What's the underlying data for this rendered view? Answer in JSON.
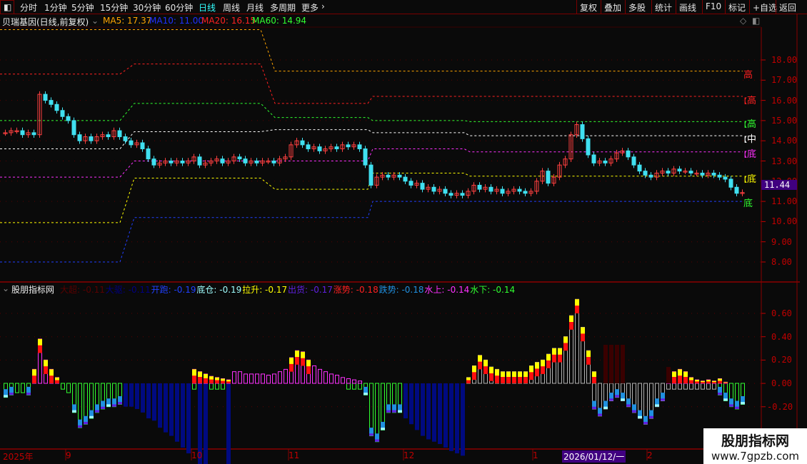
{
  "toolbar": {
    "tabs": [
      "分时",
      "1分钟",
      "5分钟",
      "15分钟",
      "30分钟",
      "60分钟",
      "日线",
      "周线",
      "月线",
      "多周期",
      "更多"
    ],
    "active": "日线",
    "right_buttons": [
      "复权",
      "叠加",
      "多股",
      "统计",
      "画线",
      "F10",
      "标记",
      "+自选",
      "返回"
    ]
  },
  "info": {
    "title": "贝瑞基因(日线,前复权)",
    "ma5": "MA5: 17.37",
    "ma10": "MA10: 11.00",
    "ma20": "MA20: 16.15",
    "ma60": "MA60: 14.94"
  },
  "indicator": {
    "name": "股朋指标网",
    "items": [
      {
        "t": "大超: -0.11",
        "c": "#5a0000"
      },
      {
        "t": "大驱: -0.11",
        "c": "#000080"
      },
      {
        "t": "开跑: -0.19",
        "c": "#2040ff"
      },
      {
        "t": "底仓: -0.19",
        "c": "#a0ffff"
      },
      {
        "t": "拉升: -0.17",
        "c": "#ffff00"
      },
      {
        "t": "出货: -0.17",
        "c": "#6020e0"
      },
      {
        "t": "涨势: -0.18",
        "c": "#ff2020"
      },
      {
        "t": "跌势: -0.18",
        "c": "#2090e0"
      },
      {
        "t": "水上: -0.14",
        "c": "#ff30ff"
      },
      {
        "t": "水下: -0.14",
        "c": "#30ff30"
      }
    ]
  },
  "price_axis": [
    "18.00",
    "17.00",
    "16.00",
    "15.00",
    "14.00",
    "13.00",
    "12.00",
    "11.00",
    "10.00",
    "9.00",
    "8.00"
  ],
  "current_price": "11.44",
  "ind_axis": [
    "0.60",
    "0.40",
    "0.20",
    "0.00",
    "-0.20"
  ],
  "band_labels": [
    {
      "t": "高",
      "c": "#ff2020",
      "bracket": false
    },
    {
      "t": "高",
      "c": "#ff2020",
      "bracket": true
    },
    {
      "t": "高",
      "c": "#30ff30",
      "bracket": true
    },
    {
      "t": "中",
      "c": "#ffffff",
      "bracket": true
    },
    {
      "t": "底",
      "c": "#ff30ff",
      "bracket": true
    },
    {
      "t": "底",
      "c": "#ffff00",
      "bracket": true
    },
    {
      "t": "底",
      "c": "#30ff30",
      "bracket": false
    }
  ],
  "date_axis": [
    "2025年",
    "9",
    "10",
    "11",
    "12",
    "1",
    "2026/01/12/一",
    "2"
  ],
  "watermark": {
    "name": "股朋指标网",
    "url": "www.7gpzb.com"
  },
  "chart_data": {
    "type": "candlestick",
    "closes": [
      14.4,
      14.5,
      14.5,
      14.3,
      14.4,
      14.3,
      16.3,
      16.0,
      15.8,
      15.5,
      15.2,
      15.0,
      14.3,
      14.0,
      14.2,
      14.0,
      14.2,
      14.3,
      14.2,
      14.5,
      14.2,
      14.0,
      13.8,
      13.9,
      13.6,
      13.1,
      12.8,
      12.9,
      13.0,
      12.9,
      13.0,
      12.9,
      13.0,
      13.2,
      12.8,
      12.9,
      13.0,
      13.1,
      12.9,
      13.0,
      13.2,
      13.1,
      12.9,
      13.0,
      12.9,
      13.0,
      13.0,
      12.9,
      13.1,
      13.2,
      13.8,
      14.0,
      13.8,
      13.6,
      13.7,
      13.5,
      13.6,
      13.7,
      13.6,
      13.8,
      13.7,
      13.8,
      13.6,
      12.8,
      11.8,
      12.2,
      12.3,
      12.2,
      12.3,
      12.2,
      12.0,
      11.8,
      11.9,
      11.6,
      11.7,
      11.5,
      11.6,
      11.4,
      11.3,
      11.4,
      11.3,
      11.5,
      11.8,
      11.6,
      11.7,
      11.5,
      11.6,
      11.4,
      11.5,
      11.6,
      11.5,
      11.4,
      11.5,
      12.0,
      12.5,
      11.9,
      12.2,
      12.8,
      13.1,
      14.3,
      14.8,
      14.1,
      13.3,
      12.9,
      13.0,
      12.9,
      13.1,
      13.4,
      13.5,
      13.2,
      12.8,
      12.5,
      12.3,
      12.2,
      12.4,
      12.5,
      12.4,
      12.6,
      12.5,
      12.5,
      12.4,
      12.4,
      12.3,
      12.4,
      12.3,
      12.2,
      12.1,
      11.7,
      11.4,
      11.44
    ],
    "bands": [
      {
        "color": "#ffa500",
        "levels": [
          19.5,
          19.5,
          17.45,
          17.45,
          17.45
        ]
      },
      {
        "color": "#ff2020",
        "levels": [
          17.3,
          17.8,
          15.85,
          16.2,
          16.2
        ]
      },
      {
        "color": "#30ff30",
        "levels": [
          15.0,
          15.85,
          15.15,
          15.0,
          14.95
        ]
      },
      {
        "color": "#ffffff",
        "levels": [
          13.6,
          14.45,
          14.55,
          14.4,
          14.25
        ]
      },
      {
        "color": "#ff30ff",
        "levels": [
          12.2,
          13.0,
          13.0,
          13.6,
          13.45
        ]
      },
      {
        "color": "#ffff00",
        "levels": [
          9.95,
          12.15,
          11.6,
          12.4,
          12.25
        ]
      },
      {
        "color": "#2040ff",
        "levels": [
          8.0,
          10.2,
          10.2,
          11.0,
          11.0
        ]
      }
    ],
    "ind_pos": [
      0,
      0,
      0,
      0,
      0,
      0.12,
      0.38,
      0.2,
      0.12,
      0.05,
      0,
      0,
      0,
      0,
      0,
      0,
      0,
      0,
      0,
      0,
      0,
      0,
      0,
      0,
      0,
      0,
      0,
      0,
      0,
      0,
      0,
      0,
      0,
      0.12,
      0.1,
      0.08,
      0.06,
      0.05,
      0.04,
      0.03,
      0.1,
      0.1,
      0.08,
      0.08,
      0.08,
      0.08,
      0.07,
      0.08,
      0.1,
      0.12,
      0.22,
      0.28,
      0.27,
      0.2,
      0.15,
      0.12,
      0.1,
      0.08,
      0.07,
      0.05,
      0.04,
      0.03,
      0.02,
      0,
      0,
      0,
      0,
      0,
      0,
      0,
      0,
      0,
      0,
      0,
      0,
      0,
      0,
      0,
      0,
      0,
      0,
      0.05,
      0.15,
      0.24,
      0.2,
      0.14,
      0.12,
      0.1,
      0.1,
      0.1,
      0.1,
      0.1,
      0.15,
      0.18,
      0.2,
      0.25,
      0.3,
      0.3,
      0.4,
      0.58,
      0.72,
      0.48,
      0.28,
      0.1,
      0,
      0,
      0,
      0,
      0,
      0,
      0,
      0,
      0,
      0,
      0,
      0,
      0.05,
      0.1,
      0.12,
      0.1,
      0.05,
      0.03,
      0.02,
      0.03,
      0.02,
      0.04,
      0.01,
      0,
      0,
      0
    ],
    "ind_neg": [
      -0.12,
      -0.1,
      -0.08,
      -0.08,
      -0.1,
      0,
      0,
      0,
      0,
      0,
      -0.05,
      -0.08,
      -0.25,
      -0.38,
      -0.35,
      -0.3,
      -0.25,
      -0.22,
      -0.2,
      -0.2,
      -0.18,
      -0.2,
      -0.2,
      -0.22,
      -0.25,
      -0.3,
      -0.32,
      -0.38,
      -0.42,
      -0.45,
      -0.5,
      -0.55,
      -0.6,
      -0.05,
      -0.7,
      -0.7,
      -0.05,
      -0.05,
      -0.05,
      -0.7,
      0,
      0,
      0,
      0,
      0,
      0,
      0,
      0,
      0,
      0,
      0,
      0,
      0,
      0,
      0,
      0,
      0,
      0,
      0,
      0,
      -0.05,
      -0.05,
      -0.05,
      -0.1,
      -0.45,
      -0.5,
      -0.4,
      -0.25,
      -0.25,
      -0.25,
      -0.3,
      -0.35,
      -0.4,
      -0.45,
      -0.48,
      -0.5,
      -0.52,
      -0.55,
      -0.58,
      -0.6,
      -0.62,
      0,
      0,
      0,
      0,
      0,
      0,
      0,
      0,
      0,
      0,
      0,
      0,
      0,
      0,
      0,
      0,
      0,
      0,
      0,
      0,
      0,
      0,
      -0.22,
      -0.28,
      -0.22,
      -0.15,
      -0.12,
      -0.15,
      -0.2,
      -0.25,
      -0.3,
      -0.35,
      -0.3,
      -0.2,
      -0.15,
      -0.05,
      -0.05,
      -0.05,
      -0.05,
      -0.05,
      -0.05,
      -0.05,
      -0.05,
      -0.05,
      -0.1,
      -0.15,
      -0.2,
      -0.22,
      -0.18
    ]
  }
}
